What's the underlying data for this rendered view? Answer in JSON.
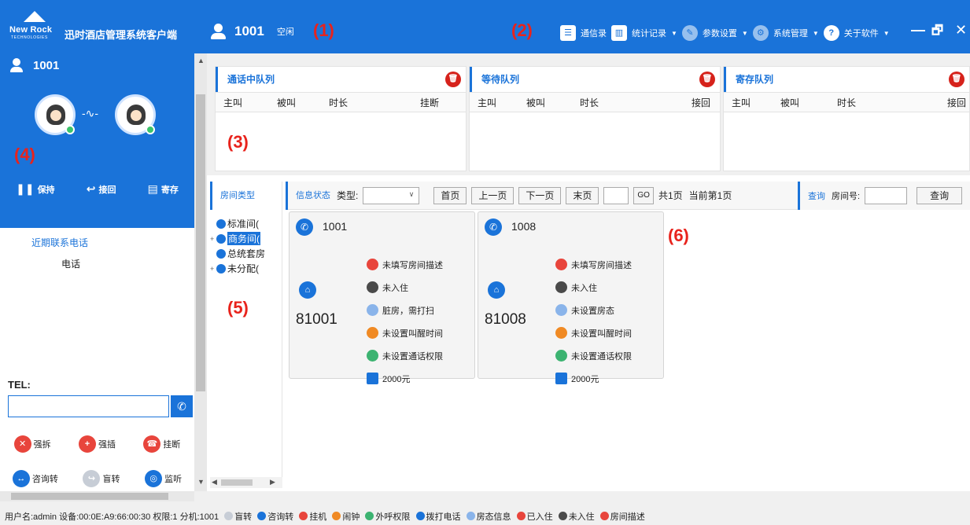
{
  "titlebar": {
    "logo_text": "New Rock",
    "logo_sub": "TECHNOLOGIES",
    "app_title": "迅时酒店管理系统客户端",
    "extension": "1001",
    "ext_state": "空闲",
    "callout1": "(1)",
    "callout2": "(2)",
    "menu": [
      {
        "label": "通信录",
        "icon": "contacts-icon"
      },
      {
        "label": "统计记录",
        "icon": "stats-icon"
      },
      {
        "label": "参数设置",
        "icon": "settings-icon"
      },
      {
        "label": "系统管理",
        "icon": "gear-icon"
      },
      {
        "label": "关于软件",
        "icon": "help-icon"
      }
    ],
    "win": {
      "minimize": "—",
      "restore": "🗗",
      "close": "✕"
    }
  },
  "left": {
    "user": "1001",
    "callout4": "(4)",
    "actions": [
      {
        "label": "保持",
        "icon": "hold-icon"
      },
      {
        "label": "接回",
        "icon": "retrieve-icon"
      },
      {
        "label": "寄存",
        "icon": "park-icon"
      }
    ],
    "recent_title": "近期联系电话",
    "recent_col": "电话",
    "tel_label": "TEL:",
    "ops_row1": [
      {
        "label": "强拆",
        "color": "#e8453c",
        "glyph": "✕"
      },
      {
        "label": "强插",
        "color": "#e8453c",
        "glyph": "+"
      },
      {
        "label": "挂断",
        "color": "#e8453c",
        "glyph": "☎"
      }
    ],
    "ops_row2": [
      {
        "label": "咨询转",
        "color": "#1a73d9",
        "glyph": "↔"
      },
      {
        "label": "盲转",
        "color": "#c7cdd6",
        "glyph": "↪"
      },
      {
        "label": "监听",
        "color": "#1a73d9",
        "glyph": "◎"
      }
    ]
  },
  "queues": {
    "callout3": "(3)",
    "panels": [
      {
        "title": "通话中队列",
        "cols": [
          "主叫",
          "被叫",
          "时长",
          "挂断"
        ]
      },
      {
        "title": "等待队列",
        "cols": [
          "主叫",
          "被叫",
          "时长",
          "接回"
        ]
      },
      {
        "title": "寄存队列",
        "cols": [
          "主叫",
          "被叫",
          "时长",
          "接回"
        ]
      }
    ]
  },
  "rooms": {
    "types_title": "房间类型",
    "callout5": "(5)",
    "callout6": "(6)",
    "tree": [
      {
        "label": "标准间(",
        "pm": ""
      },
      {
        "label": "商务间(",
        "pm": "+",
        "selected": true
      },
      {
        "label": "总统套房",
        "pm": ""
      },
      {
        "label": "未分配(",
        "pm": "+"
      }
    ],
    "info_title": "信息状态",
    "type_label": "类型:",
    "btn_first": "首页",
    "btn_prev": "上一页",
    "btn_next": "下一页",
    "btn_last": "末页",
    "btn_go": "GO",
    "total_pages": "共1页",
    "current_page": "当前第1页",
    "query_link": "查询",
    "room_no_label": "房间号:",
    "query_btn": "查询",
    "cards": [
      {
        "ext": "1001",
        "room": "81001",
        "attrs": [
          {
            "text": "未填写房间描述",
            "color": "#e8453c"
          },
          {
            "text": "未入住",
            "color": "#4a4a4a"
          },
          {
            "text": "脏房，需打扫",
            "color": "#8ab4ea"
          },
          {
            "text": "未设置叫醒时间",
            "color": "#f08a24"
          },
          {
            "text": "未设置通话权限",
            "color": "#3cb371"
          },
          {
            "text": "2000元",
            "color": "#1a73d9"
          }
        ]
      },
      {
        "ext": "1008",
        "room": "81008",
        "attrs": [
          {
            "text": "未填写房间描述",
            "color": "#e8453c"
          },
          {
            "text": "未入住",
            "color": "#4a4a4a"
          },
          {
            "text": "未设置房态",
            "color": "#8ab4ea"
          },
          {
            "text": "未设置叫醒时间",
            "color": "#f08a24"
          },
          {
            "text": "未设置通话权限",
            "color": "#3cb371"
          },
          {
            "text": "2000元",
            "color": "#1a73d9"
          }
        ]
      }
    ]
  },
  "status": {
    "user": "用户名:admin",
    "device": "设备:00:0E:A9:66:00:30",
    "perm": "权限:1",
    "ext": "分机:1001",
    "legend": [
      {
        "text": "盲转",
        "color": "#c7cdd6"
      },
      {
        "text": "咨询转",
        "color": "#1a73d9"
      },
      {
        "text": "挂机",
        "color": "#e8453c"
      },
      {
        "text": "闹钟",
        "color": "#f08a24"
      },
      {
        "text": "外呼权限",
        "color": "#3cb371"
      },
      {
        "text": "拨打电话",
        "color": "#1a73d9"
      },
      {
        "text": "房态信息",
        "color": "#8ab4ea"
      },
      {
        "text": "已入住",
        "color": "#e8453c"
      },
      {
        "text": "未入住",
        "color": "#4a4a4a"
      },
      {
        "text": "房间描述",
        "color": "#e8453c"
      }
    ]
  }
}
